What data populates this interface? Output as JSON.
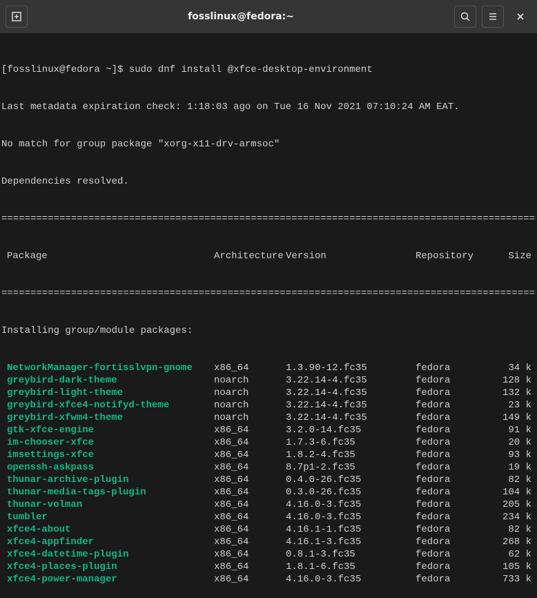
{
  "titlebar": {
    "title": "fosslinux@fedora:~"
  },
  "prompt": {
    "user_host": "[fosslinux@fedora ~]$ ",
    "command": "sudo dnf install @xfce-desktop-environment"
  },
  "output": {
    "line1": "Last metadata expiration check: 1:18:03 ago on Tue 16 Nov 2021 07:10:24 AM EAT.",
    "line2": "No match for group package \"xorg-x11-drv-armsoc\"",
    "line3": "Dependencies resolved."
  },
  "columns": {
    "package": "Package",
    "architecture": "Architecture",
    "version": "Version",
    "repository": "Repository",
    "size": "Size"
  },
  "section_header": "Installing group/module packages:",
  "packages": [
    {
      "name": "NetworkManager-fortisslvpn-gnome",
      "arch": "x86_64",
      "ver": "1.3.90-12.fc35",
      "repo": "fedora",
      "size": "34 k"
    },
    {
      "name": "greybird-dark-theme",
      "arch": "noarch",
      "ver": "3.22.14-4.fc35",
      "repo": "fedora",
      "size": "128 k"
    },
    {
      "name": "greybird-light-theme",
      "arch": "noarch",
      "ver": "3.22.14-4.fc35",
      "repo": "fedora",
      "size": "132 k"
    },
    {
      "name": "greybird-xfce4-notifyd-theme",
      "arch": "noarch",
      "ver": "3.22.14-4.fc35",
      "repo": "fedora",
      "size": "23 k"
    },
    {
      "name": "greybird-xfwm4-theme",
      "arch": "noarch",
      "ver": "3.22.14-4.fc35",
      "repo": "fedora",
      "size": "149 k"
    },
    {
      "name": "gtk-xfce-engine",
      "arch": "x86_64",
      "ver": "3.2.0-14.fc35",
      "repo": "fedora",
      "size": "91 k"
    },
    {
      "name": "im-chooser-xfce",
      "arch": "x86_64",
      "ver": "1.7.3-6.fc35",
      "repo": "fedora",
      "size": "20 k"
    },
    {
      "name": "imsettings-xfce",
      "arch": "x86_64",
      "ver": "1.8.2-4.fc35",
      "repo": "fedora",
      "size": "93 k"
    },
    {
      "name": "openssh-askpass",
      "arch": "x86_64",
      "ver": "8.7p1-2.fc35",
      "repo": "fedora",
      "size": "19 k"
    },
    {
      "name": "thunar-archive-plugin",
      "arch": "x86_64",
      "ver": "0.4.0-26.fc35",
      "repo": "fedora",
      "size": "82 k"
    },
    {
      "name": "thunar-media-tags-plugin",
      "arch": "x86_64",
      "ver": "0.3.0-26.fc35",
      "repo": "fedora",
      "size": "104 k"
    },
    {
      "name": "thunar-volman",
      "arch": "x86_64",
      "ver": "4.16.0-3.fc35",
      "repo": "fedora",
      "size": "205 k"
    },
    {
      "name": "tumbler",
      "arch": "x86_64",
      "ver": "4.16.0-3.fc35",
      "repo": "fedora",
      "size": "234 k"
    },
    {
      "name": "xfce4-about",
      "arch": "x86_64",
      "ver": "4.16.1-1.fc35",
      "repo": "fedora",
      "size": "82 k"
    },
    {
      "name": "xfce4-appfinder",
      "arch": "x86_64",
      "ver": "4.16.1-3.fc35",
      "repo": "fedora",
      "size": "268 k"
    },
    {
      "name": "xfce4-datetime-plugin",
      "arch": "x86_64",
      "ver": "0.8.1-3.fc35",
      "repo": "fedora",
      "size": "62 k"
    },
    {
      "name": "xfce4-places-plugin",
      "arch": "x86_64",
      "ver": "1.8.1-6.fc35",
      "repo": "fedora",
      "size": "105 k"
    },
    {
      "name": "xfce4-power-manager",
      "arch": "x86_64",
      "ver": "4.16.0-3.fc35",
      "repo": "fedora",
      "size": "733 k"
    }
  ],
  "ruler": "================================================================================================"
}
